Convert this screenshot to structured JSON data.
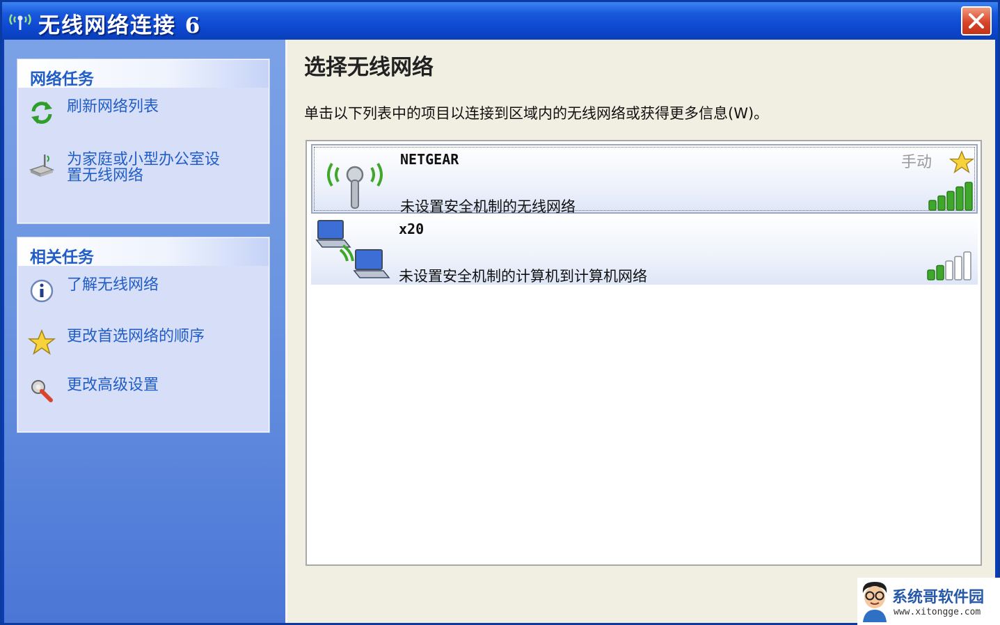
{
  "window": {
    "title": "无线网络连接 6"
  },
  "sidebar": {
    "network_tasks": {
      "header": "网络任务",
      "items": [
        {
          "label": "刷新网络列表",
          "icon": "refresh-icon"
        },
        {
          "label": "为家庭或小型办公室设置无线网络",
          "line1": "为家庭或小型办公室设",
          "line2": "置无线网络",
          "icon": "wireless-setup-icon"
        }
      ]
    },
    "related_tasks": {
      "header": "相关任务",
      "items": [
        {
          "label": "了解无线网络",
          "icon": "info-icon"
        },
        {
          "label": "更改首选网络的顺序",
          "icon": "star-icon"
        },
        {
          "label": "更改高级设置",
          "icon": "advanced-settings-icon"
        }
      ]
    }
  },
  "main": {
    "title": "选择无线网络",
    "description": "单击以下列表中的项目以连接到区域内的无线网络或获得更多信息(W)。",
    "networks": [
      {
        "ssid": "NETGEAR",
        "status": "未设置安全机制的无线网络",
        "mode": "手动",
        "preferred": true,
        "signal_bars": 5,
        "signal_total": 5,
        "selected": true,
        "icon": "wireless-antenna-icon"
      },
      {
        "ssid": "x20",
        "status": "未设置安全机制的计算机到计算机网络",
        "mode": "",
        "preferred": false,
        "signal_bars": 2,
        "signal_total": 5,
        "selected": false,
        "icon": "adhoc-computers-icon"
      }
    ]
  },
  "watermark": {
    "name": "系统哥软件园",
    "url": "www.xitongge.com"
  },
  "colors": {
    "title_bar": "#0a47d0",
    "sidebar": "#6a94e0",
    "link": "#215dc6",
    "signal": "#3fa82a",
    "close": "#d9452a"
  }
}
